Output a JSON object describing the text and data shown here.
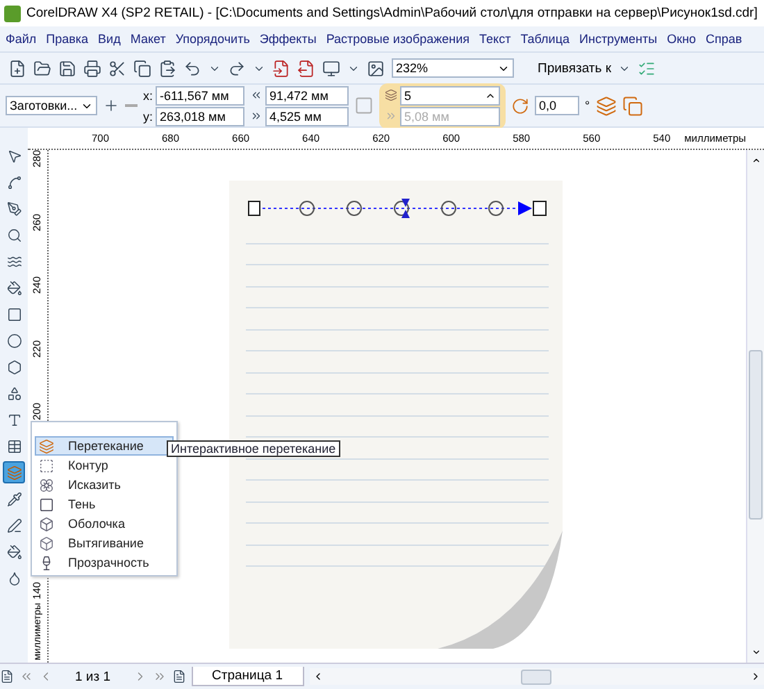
{
  "window": {
    "title": "CorelDRAW X4 (SP2 RETAIL) - [C:\\Documents and Settings\\Admin\\Рабочий стол\\для отправки на сервер\\Рисунок1sd.cdr]"
  },
  "menu": [
    "Файл",
    "Правка",
    "Вид",
    "Макет",
    "Упорядочить",
    "Эффекты",
    "Растровые изображения",
    "Текст",
    "Таблица",
    "Инструменты",
    "Окно",
    "Справ"
  ],
  "toolbar": {
    "zoom": "232%",
    "snap": "Привязать к"
  },
  "property_bar": {
    "presets": "Заготовки...",
    "x_label": "x:",
    "x": "-611,567 мм",
    "y_label": "y:",
    "y": "263,018 мм",
    "width": "91,472 мм",
    "height": "4,525 мм",
    "steps": "5",
    "spacing": "5,08 мм",
    "spacing_disabled": true,
    "angle": "0,0",
    "degree": "°"
  },
  "ruler": {
    "labels": [
      "700",
      "680",
      "660",
      "640",
      "620",
      "600",
      "580",
      "560",
      "540"
    ],
    "unit": "миллиметры"
  },
  "vertical_ruler": {
    "labels": [
      "280",
      "260",
      "240",
      "220",
      "200",
      "140"
    ],
    "unit": "миллиметры"
  },
  "toolbox": [
    {
      "kind": "pick",
      "selected": false
    },
    {
      "kind": "shape",
      "selected": false
    },
    {
      "kind": "pen",
      "selected": false
    },
    {
      "kind": "zoom",
      "selected": false
    },
    {
      "kind": "smart",
      "selected": false
    },
    {
      "kind": "smartfill",
      "selected": false
    },
    {
      "kind": "rect",
      "selected": false
    },
    {
      "kind": "ellipse",
      "selected": false
    },
    {
      "kind": "polygon",
      "selected": false
    },
    {
      "kind": "shapes",
      "selected": false
    },
    {
      "kind": "text",
      "selected": false
    },
    {
      "kind": "table",
      "selected": false
    },
    {
      "kind": "blend",
      "selected": true
    },
    {
      "kind": "eyedropper",
      "selected": false
    },
    {
      "kind": "outline",
      "selected": false
    },
    {
      "kind": "fill",
      "selected": false
    },
    {
      "kind": "ifill",
      "selected": false
    }
  ],
  "flyout": [
    {
      "kind": "blend",
      "label": "Перетекание",
      "selected": true
    },
    {
      "kind": "contour",
      "label": "Контур",
      "selected": false
    },
    {
      "kind": "distort",
      "label": "Исказить",
      "selected": false
    },
    {
      "kind": "shadow",
      "label": "Тень",
      "selected": false
    },
    {
      "kind": "envelope",
      "label": "Оболочка",
      "selected": false
    },
    {
      "kind": "extrude",
      "label": "Вытягивание",
      "selected": false
    },
    {
      "kind": "transparency",
      "label": "Прозрачность",
      "selected": false
    }
  ],
  "tooltip": "Интерактивное перетекание",
  "page_nav": {
    "counter": "1 из 1",
    "tab": "Страница 1"
  }
}
